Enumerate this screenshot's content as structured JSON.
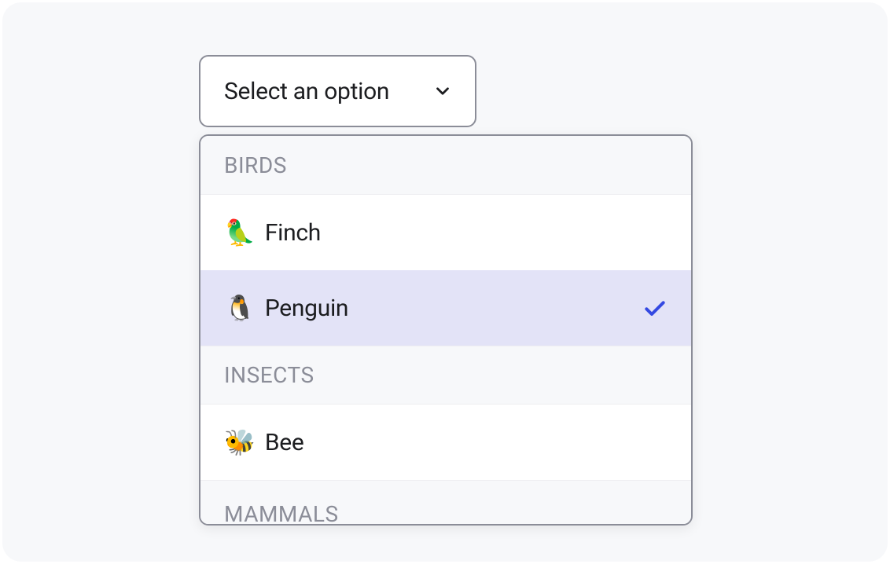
{
  "select": {
    "placeholder": "Select an option"
  },
  "groups": [
    {
      "label": "BIRDS",
      "options": [
        {
          "emoji": "🦜",
          "label": "Finch",
          "selected": false
        },
        {
          "emoji": "🐧",
          "label": "Penguin",
          "selected": true
        }
      ]
    },
    {
      "label": "INSECTS",
      "options": [
        {
          "emoji": "🐝",
          "label": "Bee",
          "selected": false
        }
      ]
    },
    {
      "label": "MAMMALS",
      "options": []
    }
  ],
  "colors": {
    "border": "#8b8d98",
    "text": "#1c1d20",
    "muted": "#8b8d98",
    "highlight": "#e3e3f7",
    "check": "#3449e2",
    "panel_bg": "#f7f8fa"
  }
}
